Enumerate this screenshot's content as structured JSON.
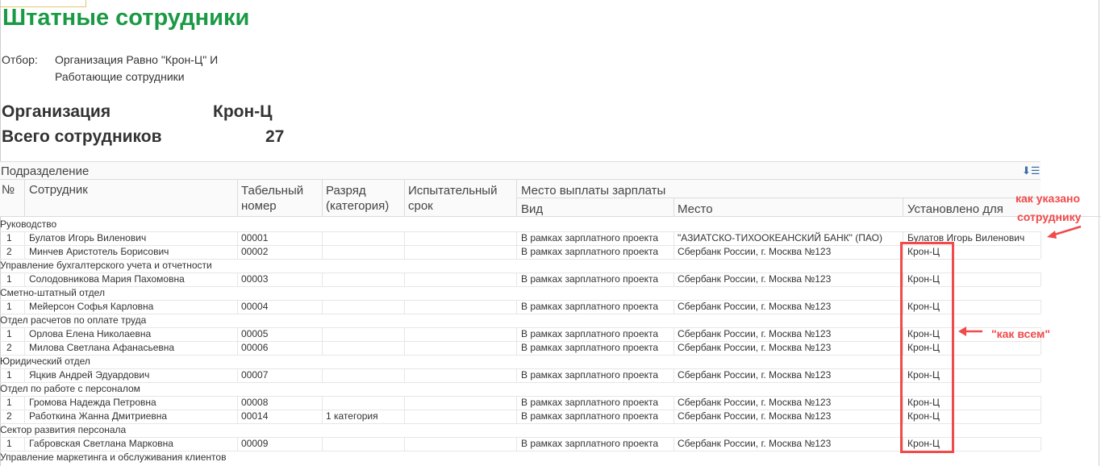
{
  "report": {
    "title": "Штатные сотрудники",
    "filter_label": "Отбор:",
    "filter_line1": "Организация Равно \"Крон-Ц\" И",
    "filter_line2": "Работающие сотрудники",
    "org_label": "Организация",
    "org_value": "Крон-Ц",
    "total_label": "Всего сотрудников",
    "total_value": "27"
  },
  "table": {
    "header": {
      "division": "Подразделение",
      "num": "№",
      "employee": "Сотрудник",
      "tab_number_1": "Табельный",
      "tab_number_2": "номер",
      "grade_1": "Разряд",
      "grade_2": "(категория)",
      "probation_1": "Испытательный",
      "probation_2": "срок",
      "payment_place": "Место выплаты зарплаты",
      "kind": "Вид",
      "place": "Место",
      "set_for": "Установлено для"
    },
    "groups": [
      {
        "name": "Руководство",
        "rows": [
          {
            "num": "1",
            "employee": "Булатов Игорь Виленович",
            "tab": "00001",
            "grade": "",
            "probation": "",
            "kind": "В рамках зарплатного проекта",
            "place": "\"АЗИАТСКО-ТИХООКЕАНСКИЙ БАНК\" (ПАО)",
            "set_for": "Булатов Игорь Виленович"
          },
          {
            "num": "2",
            "employee": "Минчев Аристотель Борисович",
            "tab": "00002",
            "grade": "",
            "probation": "",
            "kind": "В рамках зарплатного проекта",
            "place": "Сбербанк России, г. Москва №123",
            "set_for": "Крон-Ц"
          }
        ]
      },
      {
        "name": "Управление бухгалтерского учета и отчетности",
        "rows": [
          {
            "num": "1",
            "employee": "Солодовникова Мария Пахомовна",
            "tab": "00003",
            "grade": "",
            "probation": "",
            "kind": "В рамках зарплатного проекта",
            "place": "Сбербанк России, г. Москва №123",
            "set_for": "Крон-Ц"
          }
        ]
      },
      {
        "name": "Сметно-штатный отдел",
        "rows": [
          {
            "num": "1",
            "employee": "Мейерсон Софья Карловна",
            "tab": "00004",
            "grade": "",
            "probation": "",
            "kind": "В рамках зарплатного проекта",
            "place": "Сбербанк России, г. Москва №123",
            "set_for": "Крон-Ц"
          }
        ]
      },
      {
        "name": "Отдел расчетов по оплате труда",
        "rows": [
          {
            "num": "1",
            "employee": "Орлова Елена Николаевна",
            "tab": "00005",
            "grade": "",
            "probation": "",
            "kind": "В рамках зарплатного проекта",
            "place": "Сбербанк России, г. Москва №123",
            "set_for": "Крон-Ц"
          },
          {
            "num": "2",
            "employee": "Милова Светлана Афанасьевна",
            "tab": "00006",
            "grade": "",
            "probation": "",
            "kind": "В рамках зарплатного проекта",
            "place": "Сбербанк России, г. Москва №123",
            "set_for": "Крон-Ц"
          }
        ]
      },
      {
        "name": "Юридический отдел",
        "rows": [
          {
            "num": "1",
            "employee": "Яцкив Андрей Эдуардович",
            "tab": "00007",
            "grade": "",
            "probation": "",
            "kind": "В рамках зарплатного проекта",
            "place": "Сбербанк России, г. Москва №123",
            "set_for": "Крон-Ц"
          }
        ]
      },
      {
        "name": "Отдел по работе с персоналом",
        "rows": [
          {
            "num": "1",
            "employee": "Громова Надежда Петровна",
            "tab": "00008",
            "grade": "",
            "probation": "",
            "kind": "В рамках зарплатного проекта",
            "place": "Сбербанк России, г. Москва №123",
            "set_for": "Крон-Ц"
          },
          {
            "num": "2",
            "employee": "Работкина Жанна Дмитриевна",
            "tab": "00014",
            "grade": "1 категория",
            "probation": "",
            "kind": "В рамках зарплатного проекта",
            "place": "Сбербанк России, г. Москва №123",
            "set_for": "Крон-Ц"
          }
        ]
      },
      {
        "name": "Сектор развития персонала",
        "rows": [
          {
            "num": "1",
            "employee": "Габровская Светлана Марковна",
            "tab": "00009",
            "grade": "",
            "probation": "",
            "kind": "В рамках зарплатного проекта",
            "place": "Сбербанк России, г. Москва №123",
            "set_for": "Крон-Ц"
          }
        ]
      },
      {
        "name": "Управление маркетинга и обслуживания клиентов",
        "rows": []
      }
    ]
  },
  "annotations": {
    "note1_line1": "как указано",
    "note1_line2": "сотруднику",
    "note2": "\"как всем\"",
    "color": "#f04a4a"
  },
  "icons": {
    "sort": "sort-descending-icon"
  }
}
